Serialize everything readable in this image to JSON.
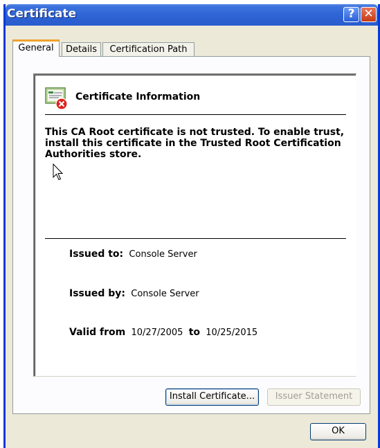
{
  "window": {
    "title": "Certificate",
    "help_symbol": "?",
    "close_symbol": "✕"
  },
  "tabs": [
    {
      "label": "General",
      "active": true
    },
    {
      "label": "Details",
      "active": false
    },
    {
      "label": "Certification Path",
      "active": false
    }
  ],
  "general": {
    "heading": "Certificate Information",
    "icon": "certificate-error-icon",
    "warning": "This CA Root certificate is not trusted. To enable trust, install this certificate in the Trusted Root Certification Authorities store.",
    "issued_to_label": "Issued to:",
    "issued_to": "Console Server",
    "issued_by_label": "Issued by:",
    "issued_by": "Console Server",
    "valid_from_label": "Valid from",
    "valid_from": "10/27/2005",
    "valid_to_label": "to",
    "valid_to": "10/25/2015"
  },
  "buttons": {
    "install": "Install Certificate...",
    "issuer_statement": "Issuer Statement",
    "ok": "OK"
  },
  "colors": {
    "titlebar": "#2f64d6",
    "dialog": "#ece9d8",
    "tab_highlight": "#f0a22b",
    "error_badge": "#e0201a"
  }
}
